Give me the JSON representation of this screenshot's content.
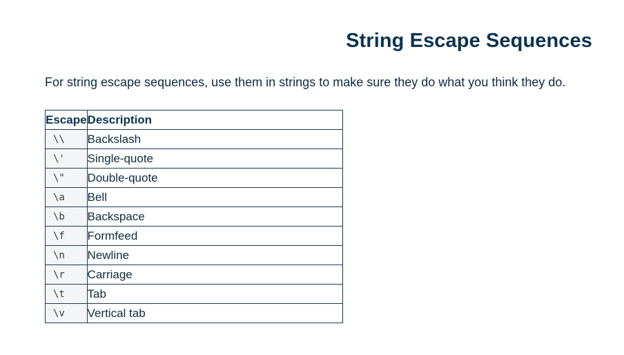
{
  "page": {
    "title": "String Escape Sequences",
    "intro": "For string escape sequences, use them in strings to make sure they do what you think they do."
  },
  "table": {
    "headers": {
      "escape": "Escape",
      "description": "Description"
    },
    "rows": [
      {
        "escape": "\\\\",
        "description": "Backslash"
      },
      {
        "escape": "\\'",
        "description": "Single-quote"
      },
      {
        "escape": "\\\"",
        "description": "Double-quote"
      },
      {
        "escape": "\\a",
        "description": "Bell"
      },
      {
        "escape": "\\b",
        "description": "Backspace"
      },
      {
        "escape": "\\f",
        "description": "Formfeed"
      },
      {
        "escape": "\\n",
        "description": "Newline"
      },
      {
        "escape": "\\r",
        "description": "Carriage"
      },
      {
        "escape": "\\t",
        "description": "Tab"
      },
      {
        "escape": "\\v",
        "description": "Vertical tab"
      }
    ]
  }
}
